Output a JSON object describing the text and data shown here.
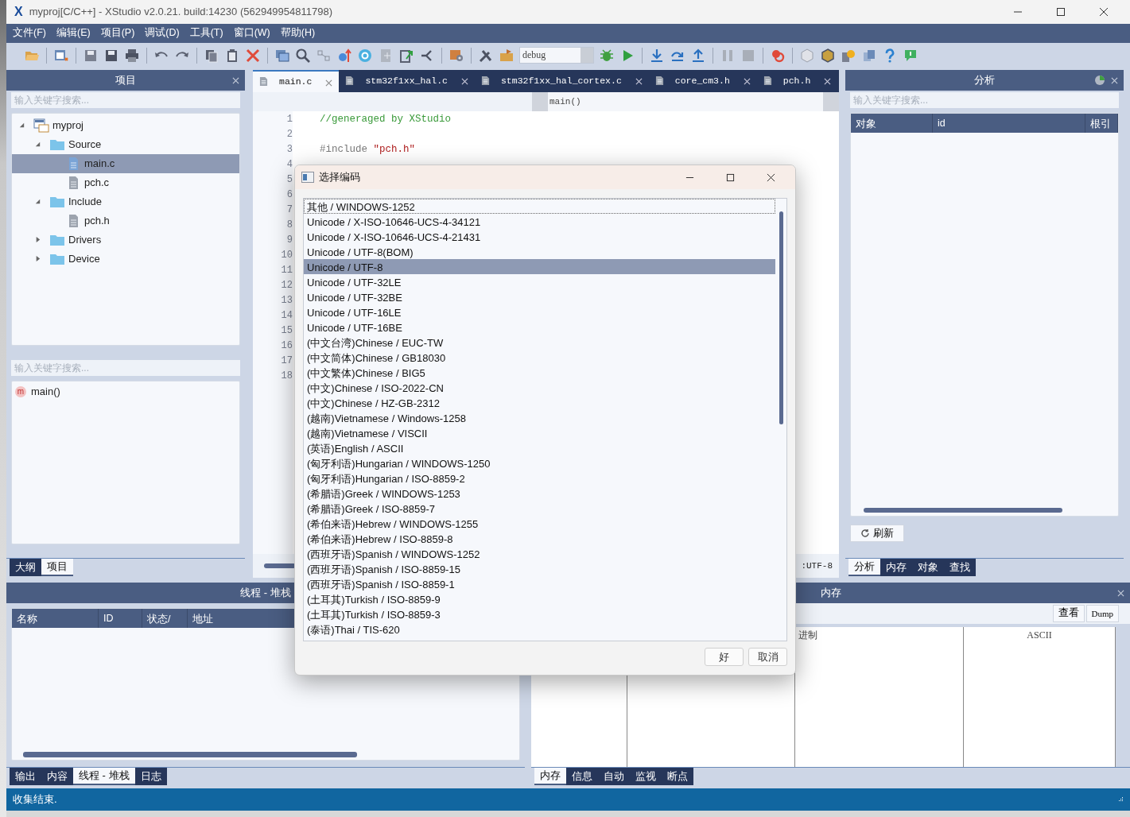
{
  "window": {
    "logo": "X",
    "title": "myproj[C/C++] - XStudio v2.0.21. build:14230 (562949954811798)"
  },
  "menu": [
    "文件(F)",
    "编辑(E)",
    "项目(P)",
    "调试(D)",
    "工具(T)",
    "窗口(W)",
    "帮助(H)"
  ],
  "toolbar": {
    "config": "debug"
  },
  "project_panel": {
    "title": "项目",
    "search": {
      "placeholder": "输入关键字搜索..."
    },
    "tree": [
      {
        "label": "myproj",
        "kind": "project",
        "expanded": true,
        "selected": false,
        "children": [
          {
            "label": "Source",
            "kind": "folder",
            "expanded": true,
            "selected": false,
            "children": [
              {
                "label": "main.c",
                "kind": "source",
                "selected": true
              },
              {
                "label": "pch.c",
                "kind": "file",
                "selected": false
              }
            ]
          },
          {
            "label": "Include",
            "kind": "folder",
            "expanded": true,
            "selected": false,
            "children": [
              {
                "label": "pch.h",
                "kind": "file",
                "selected": false
              }
            ]
          },
          {
            "label": "Drivers",
            "kind": "folder",
            "expanded": false,
            "selected": false
          },
          {
            "label": "Device",
            "kind": "folder",
            "expanded": false,
            "selected": false
          }
        ]
      }
    ],
    "outline_search": {
      "placeholder": "输入关键字搜索..."
    },
    "outline": [
      {
        "badge": "m",
        "label": "main()"
      }
    ],
    "tabs": [
      {
        "label": "大纲",
        "selected": false
      },
      {
        "label": "项目",
        "selected": true
      }
    ]
  },
  "editor": {
    "tabs": [
      {
        "label": "main.c",
        "selected": true
      },
      {
        "label": "stm32f1xx_hal.c",
        "selected": false
      },
      {
        "label": "stm32f1xx_hal_cortex.c",
        "selected": false
      },
      {
        "label": "core_cm3.h",
        "selected": false
      },
      {
        "label": "pch.h",
        "selected": false
      }
    ],
    "function": "main()",
    "line_numbers": [
      "1",
      "2",
      "3",
      "4",
      "5",
      "6",
      "7",
      "8",
      "9",
      "10",
      "11",
      "12",
      "13",
      "14",
      "15",
      "16",
      "17",
      "18"
    ],
    "lines": [
      {
        "kind": "comment",
        "text": "//generaged by XStudio"
      },
      {
        "kind": "blank"
      },
      {
        "kind": "include",
        "keyword": "#include",
        "text": "\"pch.h\""
      }
    ],
    "encoding": ":UTF-8"
  },
  "analysis_panel": {
    "title": "分析",
    "search": {
      "placeholder": "输入关键字搜索..."
    },
    "columns": [
      "对象",
      "id",
      "根引"
    ],
    "refresh": "刷新",
    "tabs": [
      {
        "label": "分析",
        "selected": true
      },
      {
        "label": "内存",
        "selected": false
      },
      {
        "label": "对象",
        "selected": false
      },
      {
        "label": "查找",
        "selected": false
      }
    ]
  },
  "thread_panel": {
    "title": "线程 - 堆栈",
    "columns": [
      "名称",
      "ID",
      "状态/",
      "地址"
    ],
    "tabs": [
      {
        "label": "输出",
        "selected": false
      },
      {
        "label": "内容",
        "selected": false
      },
      {
        "label": "线程 - 堆栈",
        "selected": true
      },
      {
        "label": "日志",
        "selected": false
      }
    ]
  },
  "memory_panel": {
    "title": "内存",
    "buttons": [
      "查看",
      "Dump"
    ],
    "columns": [
      "进制",
      "ASCII"
    ],
    "tabs": [
      {
        "label": "内存",
        "selected": true
      },
      {
        "label": "信息",
        "selected": false
      },
      {
        "label": "自动",
        "selected": false
      },
      {
        "label": "监视",
        "selected": false
      },
      {
        "label": "断点",
        "selected": false
      }
    ]
  },
  "status_bar": {
    "text": "收集结束."
  },
  "dialog": {
    "title": "选择编码",
    "items": [
      {
        "label": "其他 / WINDOWS-1252",
        "selected": false
      },
      {
        "label": "Unicode / X-ISO-10646-UCS-4-34121",
        "selected": false
      },
      {
        "label": "Unicode / X-ISO-10646-UCS-4-21431",
        "selected": false
      },
      {
        "label": "Unicode / UTF-8(BOM)",
        "selected": false
      },
      {
        "label": "Unicode / UTF-8",
        "selected": true
      },
      {
        "label": "Unicode / UTF-32LE",
        "selected": false
      },
      {
        "label": "Unicode / UTF-32BE",
        "selected": false
      },
      {
        "label": "Unicode / UTF-16LE",
        "selected": false
      },
      {
        "label": "Unicode / UTF-16BE",
        "selected": false
      },
      {
        "label": "(中文台湾)Chinese / EUC-TW",
        "selected": false
      },
      {
        "label": "(中文简体)Chinese / GB18030",
        "selected": false
      },
      {
        "label": "(中文繁体)Chinese / BIG5",
        "selected": false
      },
      {
        "label": "(中文)Chinese / ISO-2022-CN",
        "selected": false
      },
      {
        "label": "(中文)Chinese / HZ-GB-2312",
        "selected": false
      },
      {
        "label": "(越南)Vietnamese / Windows-1258",
        "selected": false
      },
      {
        "label": "(越南)Vietnamese / VISCII",
        "selected": false
      },
      {
        "label": "(英语)English / ASCII",
        "selected": false
      },
      {
        "label": "(匈牙利语)Hungarian / WINDOWS-1250",
        "selected": false
      },
      {
        "label": "(匈牙利语)Hungarian / ISO-8859-2",
        "selected": false
      },
      {
        "label": "(希腊语)Greek / WINDOWS-1253",
        "selected": false
      },
      {
        "label": "(希腊语)Greek / ISO-8859-7",
        "selected": false
      },
      {
        "label": "(希伯来语)Hebrew / WINDOWS-1255",
        "selected": false
      },
      {
        "label": "(希伯来语)Hebrew / ISO-8859-8",
        "selected": false
      },
      {
        "label": "(西班牙语)Spanish / WINDOWS-1252",
        "selected": false
      },
      {
        "label": "(西班牙语)Spanish / ISO-8859-15",
        "selected": false
      },
      {
        "label": "(西班牙语)Spanish / ISO-8859-1",
        "selected": false
      },
      {
        "label": "(土耳其)Turkish / ISO-8859-9",
        "selected": false
      },
      {
        "label": "(土耳其)Turkish / ISO-8859-3",
        "selected": false
      },
      {
        "label": "(泰语)Thai / TIS-620",
        "selected": false
      }
    ],
    "buttons": [
      "好",
      "取消"
    ]
  }
}
